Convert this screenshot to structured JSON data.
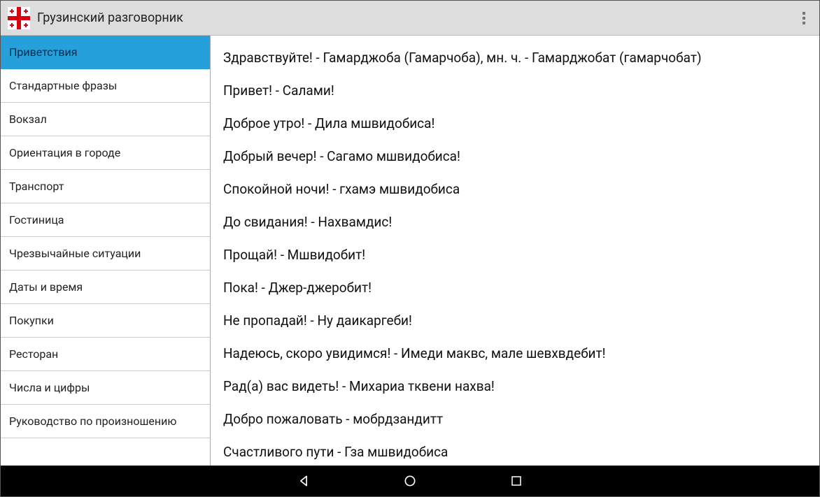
{
  "header": {
    "title": "Грузинский разговорник"
  },
  "sidebar": {
    "items": [
      {
        "label": "Приветствия",
        "active": true
      },
      {
        "label": "Стандартные фразы",
        "active": false
      },
      {
        "label": "Вокзал",
        "active": false
      },
      {
        "label": "Ориентация в городе",
        "active": false
      },
      {
        "label": "Транспорт",
        "active": false
      },
      {
        "label": "Гостиница",
        "active": false
      },
      {
        "label": "Чрезвычайные ситуации",
        "active": false
      },
      {
        "label": "Даты и время",
        "active": false
      },
      {
        "label": "Покупки",
        "active": false
      },
      {
        "label": "Ресторан",
        "active": false
      },
      {
        "label": "Числа и цифры",
        "active": false
      },
      {
        "label": "Руководство по произношению",
        "active": false
      }
    ]
  },
  "content": {
    "phrases": [
      "Здравствуйте! - Гамарджоба (Гамарчоба), мн. ч. - Гамарджобат (гамарчобат)",
      "Привет! - Салами!",
      "Доброе утро! - Дила мшвидобиса!",
      "Добрый вечер! - Сагамо мшвидобиса!",
      "Спокойной ночи! - гхамэ мшвидобиса",
      "До свидания! - Нахвамдис!",
      "Прощай! - Мшвидобит!",
      "Пока! - Джер-джеробит!",
      "Не пропадай! - Ну даикаргеби!",
      "Надеюсь, скоро увидимся! - Имеди маквс, мале шевхвдебит!",
      "Рад(а) вас видеть! - Михариа тквени нахва!",
      "Добро пожаловать - мобрдзандитт",
      "Счастливого пути - Гза мшвидобиса"
    ]
  },
  "colors": {
    "accent": "#26a0da"
  }
}
